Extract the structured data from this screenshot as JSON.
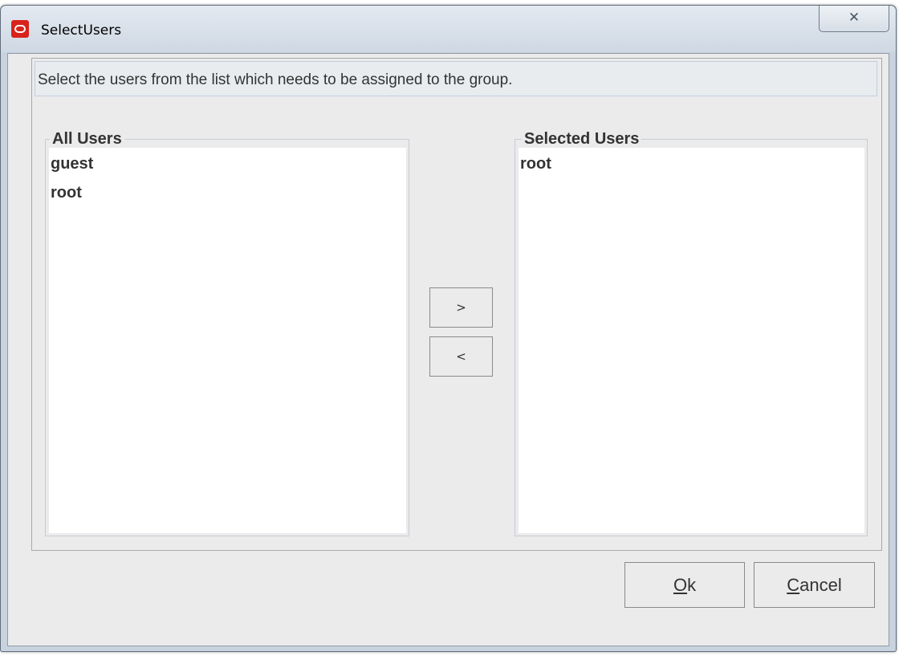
{
  "window": {
    "title": "SelectUsers",
    "close_glyph": "✕",
    "icon": "oracle-logo-icon",
    "accent": "#d9221c"
  },
  "instruction": "Select the users from the list which needs to be assigned to the group.",
  "all_users": {
    "title": "All Users",
    "items": [
      "guest",
      "root"
    ]
  },
  "selected_users": {
    "title": "Selected Users",
    "items": [
      "root"
    ]
  },
  "transfer": {
    "add_label": ">",
    "remove_label": "<"
  },
  "buttons": {
    "ok": {
      "mnemonic": "O",
      "rest": "k"
    },
    "cancel": {
      "mnemonic": "C",
      "rest": "ancel"
    }
  }
}
